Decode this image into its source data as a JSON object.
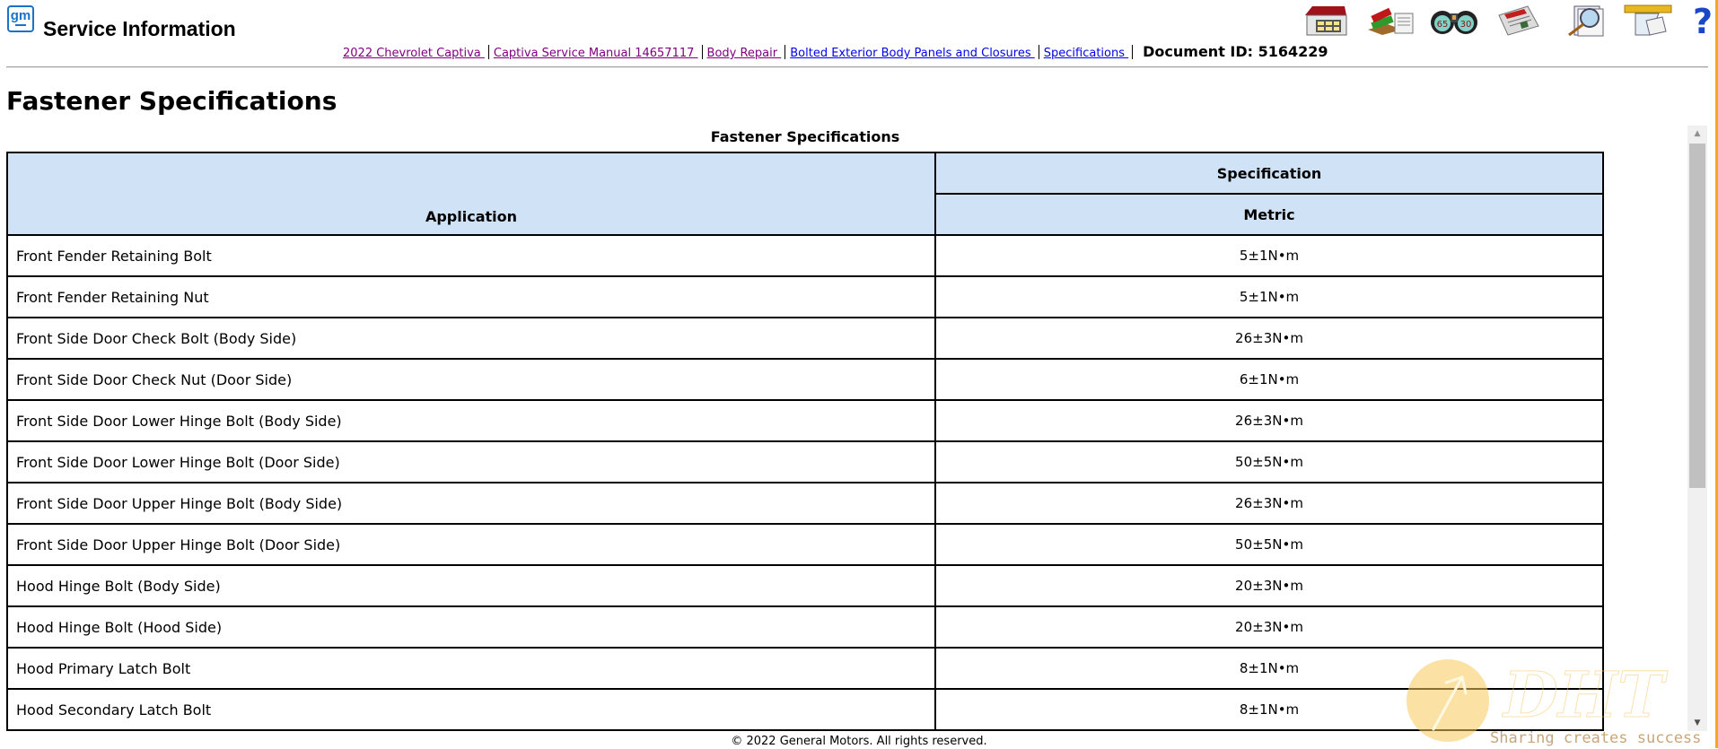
{
  "header": {
    "logo_text": "gm",
    "app_title": "Service Information",
    "toolbar": [
      {
        "name": "home-icon",
        "label": "Home"
      },
      {
        "name": "books-icon",
        "label": "Publications"
      },
      {
        "name": "binoculars-icon",
        "label": "Search",
        "badge_left": "65",
        "badge_right": "30"
      },
      {
        "name": "newspaper-icon",
        "label": "News"
      },
      {
        "name": "document-search-icon",
        "label": "Document Search"
      },
      {
        "name": "mailbox-icon",
        "label": "Feedback"
      },
      {
        "name": "help-icon",
        "label": "Help"
      }
    ],
    "breadcrumb": [
      {
        "label": "2022 Chevrolet Captiva ",
        "visited": true
      },
      {
        "label": "Captiva Service Manual 14657117 ",
        "visited": true
      },
      {
        "label": "Body Repair ",
        "visited": true
      },
      {
        "label": "Bolted Exterior Body Panels and Closures ",
        "visited": false
      },
      {
        "label": "Specifications ",
        "visited": false
      }
    ],
    "document_id": "Document ID: 5164229"
  },
  "page": {
    "title": "Fastener Specifications",
    "table_caption": "Fastener Specifications",
    "columns": {
      "application": "Application",
      "specification": "Specification",
      "metric": "Metric"
    },
    "rows": [
      {
        "application": "Front Fender Retaining Bolt",
        "metric": "5±1N•m"
      },
      {
        "application": "Front Fender Retaining Nut",
        "metric": "5±1N•m"
      },
      {
        "application": "Front Side Door Check Bolt (Body Side)",
        "metric": "26±3N•m"
      },
      {
        "application": "Front Side Door Check Nut (Door Side)",
        "metric": "6±1N•m"
      },
      {
        "application": "Front Side Door Lower Hinge Bolt (Body Side)",
        "metric": "26±3N•m"
      },
      {
        "application": "Front Side Door Lower Hinge Bolt (Door Side)",
        "metric": "50±5N•m"
      },
      {
        "application": "Front Side Door Upper Hinge Bolt (Body Side)",
        "metric": "26±3N•m"
      },
      {
        "application": "Front Side Door Upper Hinge Bolt (Door Side)",
        "metric": "50±5N•m"
      },
      {
        "application": "Hood Hinge Bolt (Body Side)",
        "metric": "20±3N•m"
      },
      {
        "application": "Hood Hinge Bolt (Hood Side)",
        "metric": "20±3N•m"
      },
      {
        "application": "Hood Primary Latch Bolt",
        "metric": "8±1N•m"
      },
      {
        "application": "Hood Secondary Latch Bolt",
        "metric": "8±1N•m"
      }
    ]
  },
  "scrollbar": {
    "up_arrow": "▲",
    "down_arrow": "▼"
  },
  "footer": {
    "copyright": "© 2022 General Motors.  All rights reserved."
  },
  "watermark": {
    "logo_text": "DHT",
    "tagline": "Sharing creates success"
  },
  "colors": {
    "header_bg": "#cfe2f6",
    "visited_link": "#800080",
    "link": "#0000ee",
    "gm_blue": "#1a73c8",
    "edge_accent": "#f5a623"
  }
}
